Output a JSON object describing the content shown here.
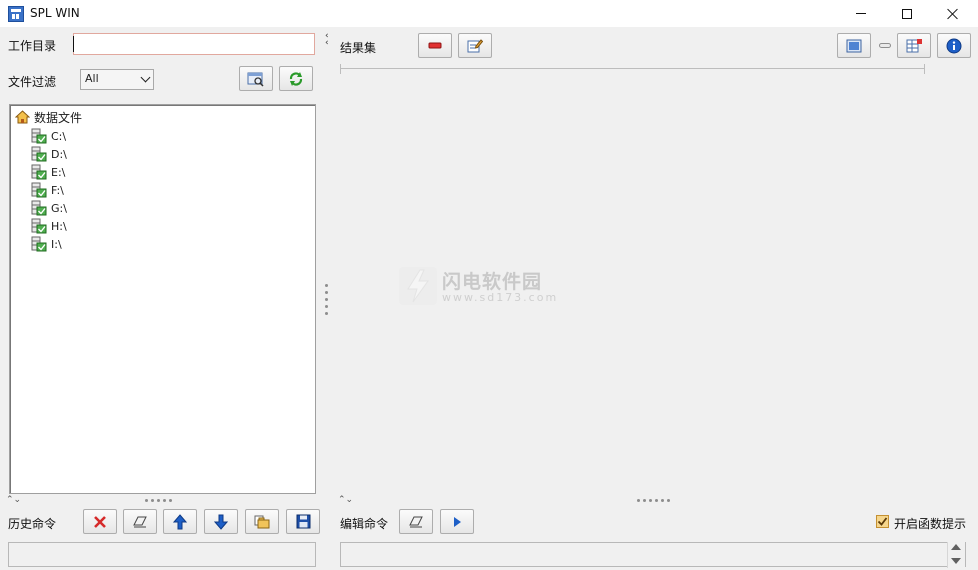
{
  "window": {
    "title": "SPL WIN"
  },
  "left": {
    "work_dir_label": "工作目录",
    "work_dir_value": "",
    "file_filter_label": "文件过滤",
    "file_filter_selected": "All",
    "tree": {
      "root_label": "数据文件",
      "drives": [
        "C:\\",
        "D:\\",
        "E:\\",
        "F:\\",
        "G:\\",
        "H:\\",
        "I:\\"
      ]
    },
    "history_label": "历史命令",
    "history_value": ""
  },
  "right": {
    "result_label": "结果集",
    "edit_cmd_label": "编辑命令",
    "edit_cmd_value": "",
    "func_hint_label": "开启函数提示",
    "func_hint_checked": true
  },
  "watermark": {
    "text": "闪电软件园",
    "sub": "www.sd173.com"
  },
  "colors": {
    "accent_blue": "#1e5fc7",
    "delete_red": "#d62a2a",
    "refresh_green": "#2a9a2a"
  }
}
